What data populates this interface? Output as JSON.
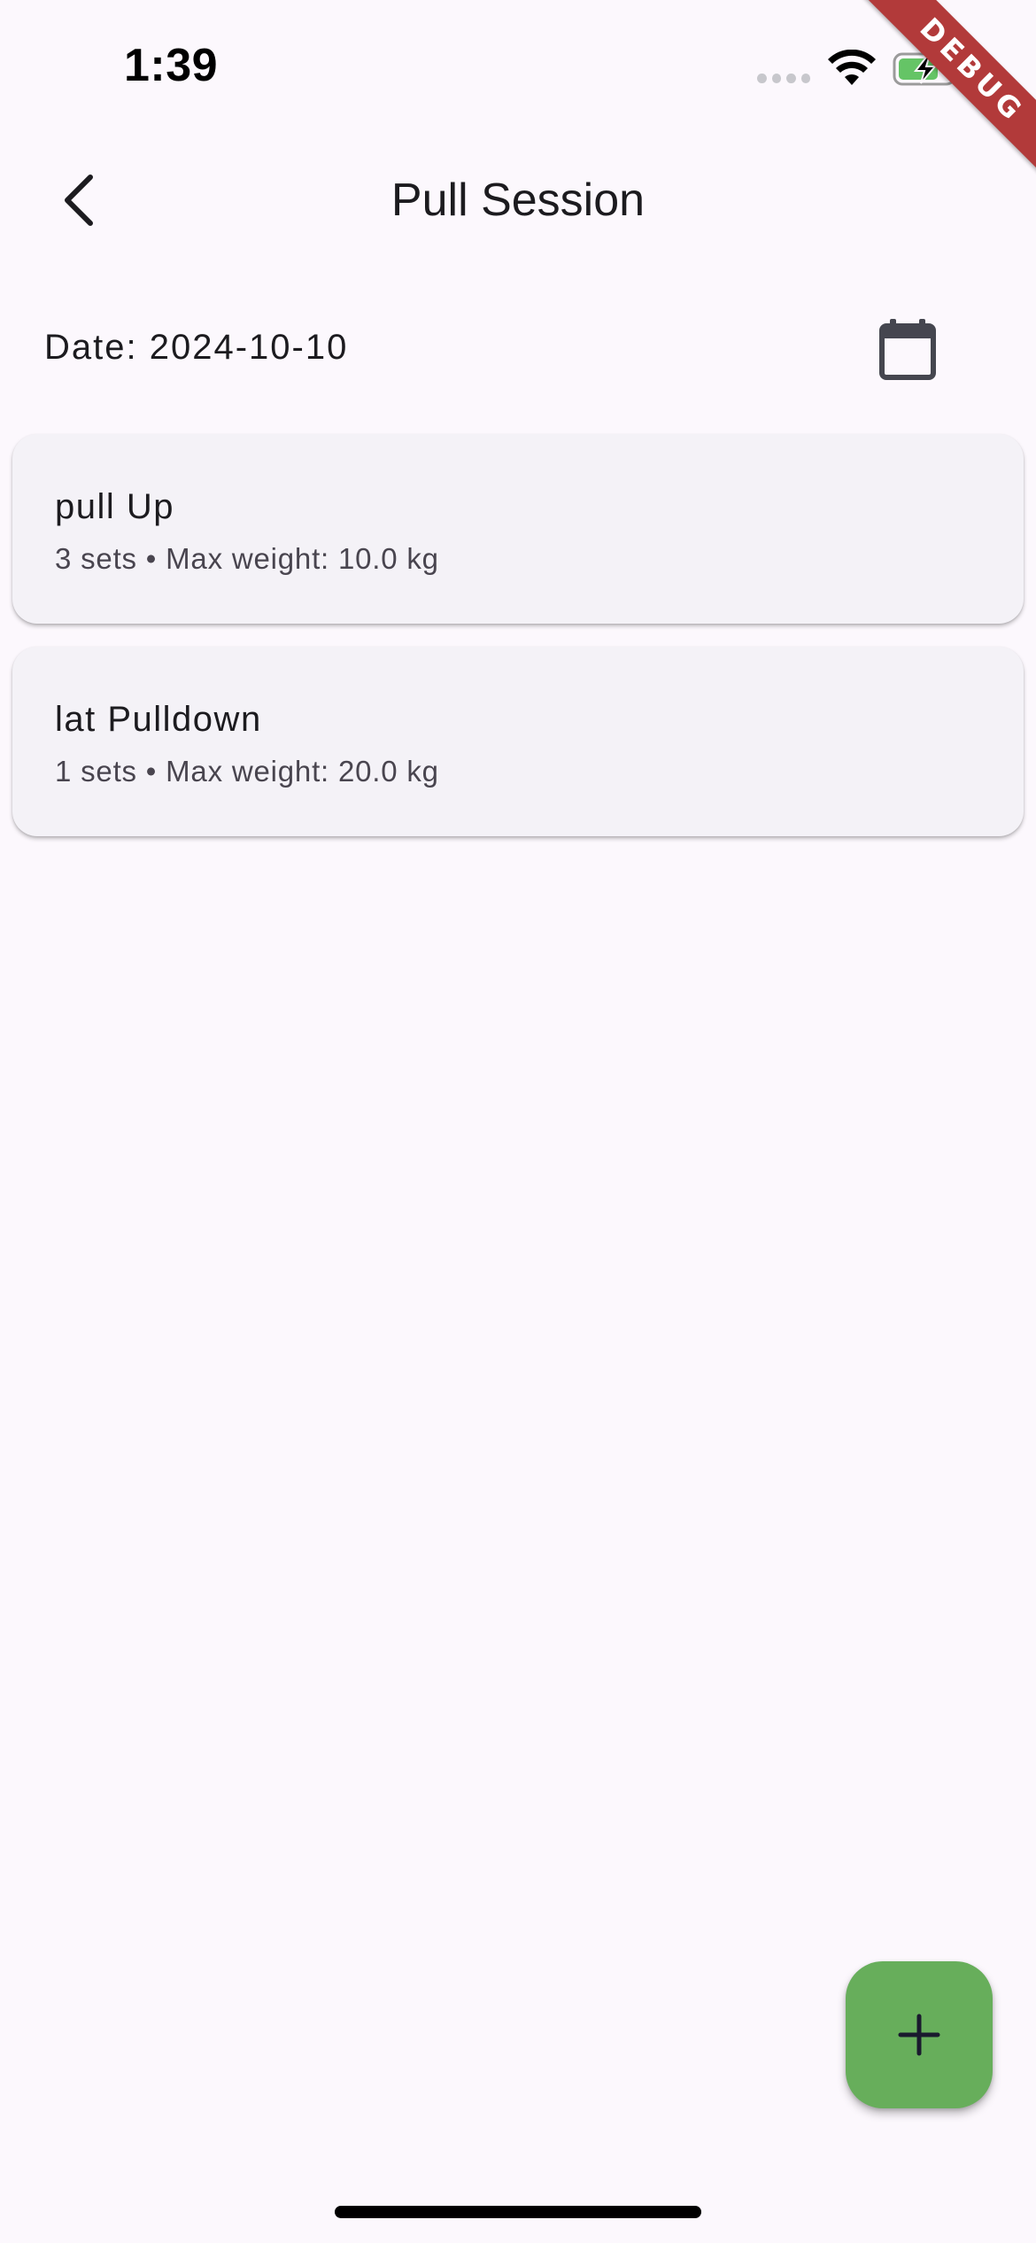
{
  "status_bar": {
    "time": "1:39"
  },
  "debug_banner": {
    "label": "DEBUG"
  },
  "app_bar": {
    "title": "Pull Session",
    "back_icon": "chevron-left-icon"
  },
  "date_row": {
    "label": "Date: 2024-10-10",
    "calendar_icon": "calendar-icon"
  },
  "exercises": [
    {
      "name": "pull Up",
      "summary": "3 sets • Max weight: 10.0 kg"
    },
    {
      "name": "lat Pulldown",
      "summary": "1 sets • Max weight: 20.0 kg"
    }
  ],
  "fab": {
    "icon": "plus-icon",
    "color": "#67ae5b"
  },
  "colors": {
    "background": "#fcf8fd",
    "card": "#f4f2f7",
    "debug": "#b23a3a",
    "battery": "#65c466"
  }
}
